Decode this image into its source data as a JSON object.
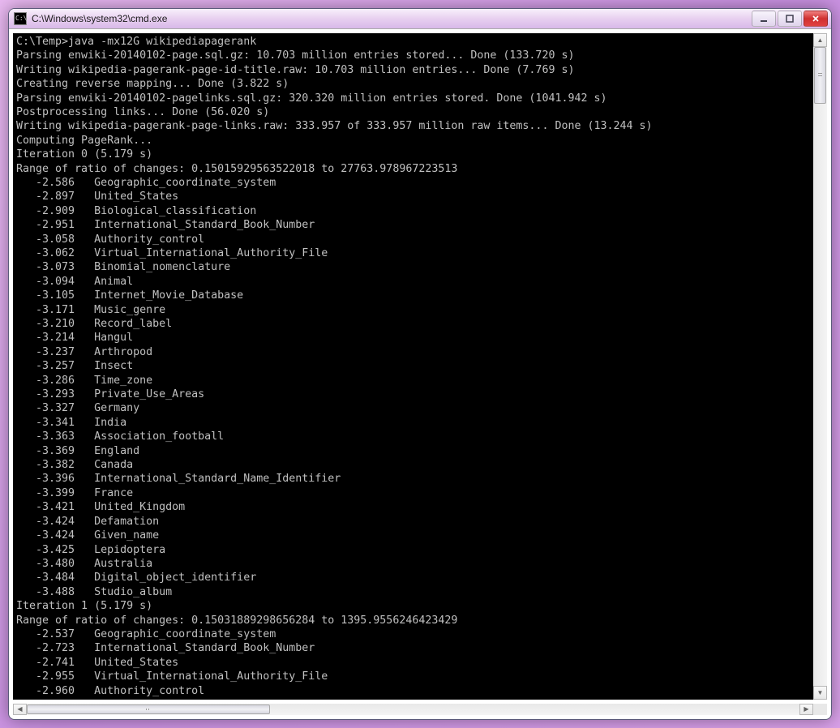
{
  "window": {
    "title": "C:\\Windows\\system32\\cmd.exe",
    "icon_text": "C:\\"
  },
  "console": {
    "prompt_line": "C:\\Temp>java -mx12G wikipediapagerank",
    "status_lines": [
      "Parsing enwiki-20140102-page.sql.gz: 10.703 million entries stored... Done (133.720 s)",
      "Writing wikipedia-pagerank-page-id-title.raw: 10.703 million entries... Done (7.769 s)",
      "Creating reverse mapping... Done (3.822 s)",
      "Parsing enwiki-20140102-pagelinks.sql.gz: 320.320 million entries stored. Done (1041.942 s)",
      "Postprocessing links... Done (56.020 s)",
      "Writing wikipedia-pagerank-page-links.raw: 333.957 of 333.957 million raw items... Done (13.244 s)",
      "Computing PageRank..."
    ],
    "iterations": [
      {
        "header": "Iteration 0 (5.179 s)",
        "range": "Range of ratio of changes: 0.15015929563522018 to 27763.978967223513",
        "rows": [
          {
            "score": "-2.586",
            "page": "Geographic_coordinate_system"
          },
          {
            "score": "-2.897",
            "page": "United_States"
          },
          {
            "score": "-2.909",
            "page": "Biological_classification"
          },
          {
            "score": "-2.951",
            "page": "International_Standard_Book_Number"
          },
          {
            "score": "-3.058",
            "page": "Authority_control"
          },
          {
            "score": "-3.062",
            "page": "Virtual_International_Authority_File"
          },
          {
            "score": "-3.073",
            "page": "Binomial_nomenclature"
          },
          {
            "score": "-3.094",
            "page": "Animal"
          },
          {
            "score": "-3.105",
            "page": "Internet_Movie_Database"
          },
          {
            "score": "-3.171",
            "page": "Music_genre"
          },
          {
            "score": "-3.210",
            "page": "Record_label"
          },
          {
            "score": "-3.214",
            "page": "Hangul"
          },
          {
            "score": "-3.237",
            "page": "Arthropod"
          },
          {
            "score": "-3.257",
            "page": "Insect"
          },
          {
            "score": "-3.286",
            "page": "Time_zone"
          },
          {
            "score": "-3.293",
            "page": "Private_Use_Areas"
          },
          {
            "score": "-3.327",
            "page": "Germany"
          },
          {
            "score": "-3.341",
            "page": "India"
          },
          {
            "score": "-3.363",
            "page": "Association_football"
          },
          {
            "score": "-3.369",
            "page": "England"
          },
          {
            "score": "-3.382",
            "page": "Canada"
          },
          {
            "score": "-3.396",
            "page": "International_Standard_Name_Identifier"
          },
          {
            "score": "-3.399",
            "page": "France"
          },
          {
            "score": "-3.421",
            "page": "United_Kingdom"
          },
          {
            "score": "-3.424",
            "page": "Defamation"
          },
          {
            "score": "-3.424",
            "page": "Given_name"
          },
          {
            "score": "-3.425",
            "page": "Lepidoptera"
          },
          {
            "score": "-3.480",
            "page": "Australia"
          },
          {
            "score": "-3.484",
            "page": "Digital_object_identifier"
          },
          {
            "score": "-3.488",
            "page": "Studio_album"
          }
        ]
      },
      {
        "header": "Iteration 1 (5.179 s)",
        "range": "Range of ratio of changes: 0.15031889298656284 to 1395.9556246423429",
        "rows": [
          {
            "score": "-2.537",
            "page": "Geographic_coordinate_system"
          },
          {
            "score": "-2.723",
            "page": "International_Standard_Book_Number"
          },
          {
            "score": "-2.741",
            "page": "United_States"
          },
          {
            "score": "-2.955",
            "page": "Virtual_International_Authority_File"
          },
          {
            "score": "-2.960",
            "page": "Authority_control"
          }
        ]
      }
    ]
  }
}
